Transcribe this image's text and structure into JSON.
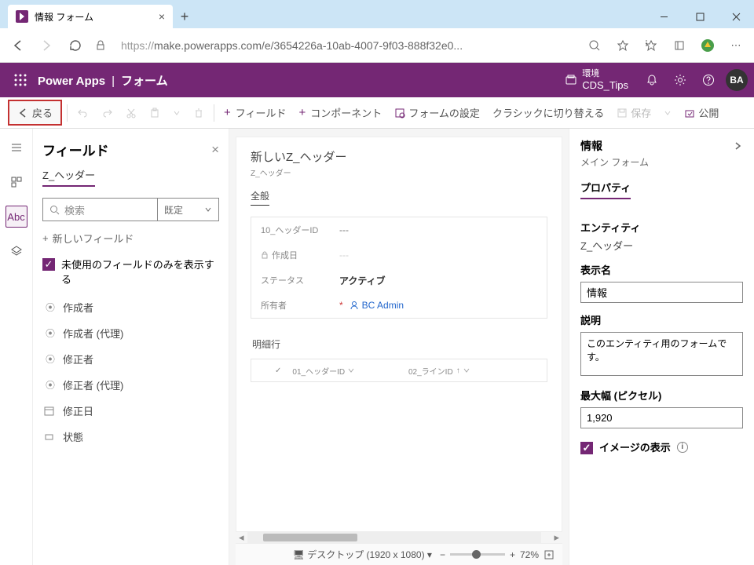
{
  "browser": {
    "tab_title": "情報 フォーム",
    "url_proto": "https://",
    "url_rest": "make.powerapps.com/e/3654226a-10ab-4007-9f03-888f32e0..."
  },
  "header": {
    "app": "Power Apps",
    "page": "フォーム",
    "env_label": "環境",
    "env_name": "CDS_Tips",
    "avatar": "BA"
  },
  "cmdbar": {
    "back": "戻る",
    "field": "フィールド",
    "component": "コンポーネント",
    "form_settings": "フォームの設定",
    "classic": "クラシックに切り替える",
    "save": "保存",
    "publish": "公開"
  },
  "fields_panel": {
    "title": "フィールド",
    "entity": "Z_ヘッダー",
    "search_ph": "検索",
    "dd": "既定",
    "new_field": "新しいフィールド",
    "unused_only": "未使用のフィールドのみを表示する",
    "items": [
      {
        "icon": "⦿",
        "label": "作成者"
      },
      {
        "icon": "⦿",
        "label": "作成者 (代理)"
      },
      {
        "icon": "⦿",
        "label": "修正者"
      },
      {
        "icon": "⦿",
        "label": "修正者 (代理)"
      },
      {
        "icon": "",
        "label": "修正日",
        "ic": "cal"
      },
      {
        "icon": "",
        "label": "状態",
        "ic": "tag"
      }
    ]
  },
  "canvas": {
    "form_title": "新しいZ_ヘッダー",
    "form_sub": "Z_ヘッダー",
    "tab": "全般",
    "rows": {
      "r1_label": "10_ヘッダーID",
      "r1_val": "---",
      "r2_label": "作成日",
      "r2_val": "---",
      "r3_label": "ステータス",
      "r3_val": "アクティブ",
      "r4_label": "所有者",
      "r4_val": "BC Admin"
    },
    "detail_section": "明細行",
    "grid": {
      "c1": "01_ヘッダーID",
      "c2": "02_ラインID"
    },
    "device": "デスクトップ (1920 x 1080)",
    "zoom": "72%"
  },
  "props": {
    "h": "情報",
    "sub": "メイン フォーム",
    "tab": "プロパティ",
    "entity_l": "エンティティ",
    "entity_v": "Z_ヘッダー",
    "disp_l": "表示名",
    "disp_v": "情報",
    "desc_l": "説明",
    "desc_v": "このエンティティ用のフォームです。",
    "maxw_l": "最大幅 (ピクセル)",
    "maxw_v": "1,920",
    "img_chk": "イメージの表示"
  }
}
